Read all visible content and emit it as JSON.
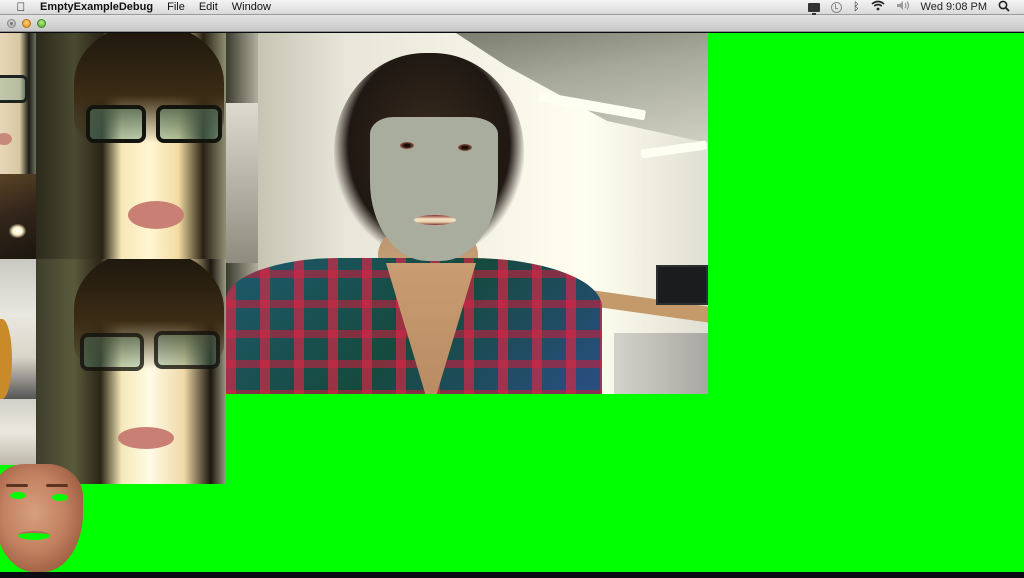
{
  "menubar": {
    "apple_icon": "apple-icon",
    "app_name": "EmptyExampleDebug",
    "menus": [
      "File",
      "Edit",
      "Window"
    ],
    "status_icons": [
      "display-mirroring-icon",
      "time-machine-icon",
      "bluetooth-icon",
      "wifi-icon",
      "volume-icon"
    ],
    "clock": "Wed 9:08 PM",
    "spotlight_icon": "spotlight-search-icon"
  },
  "window": {
    "title": "",
    "controls": [
      "close",
      "minimize",
      "zoom"
    ]
  },
  "canvas": {
    "background_color": "#00ff00",
    "views": [
      "source-face-thumbnail-1",
      "source-face-thumbnail-2",
      "webcam-feed-with-face-mask",
      "extracted-face-mask"
    ]
  },
  "glyphs": {
    "apple": "",
    "bluetooth": "ᛒ",
    "wifi": "◠",
    "volume": "◀)",
    "search": "⌕"
  }
}
